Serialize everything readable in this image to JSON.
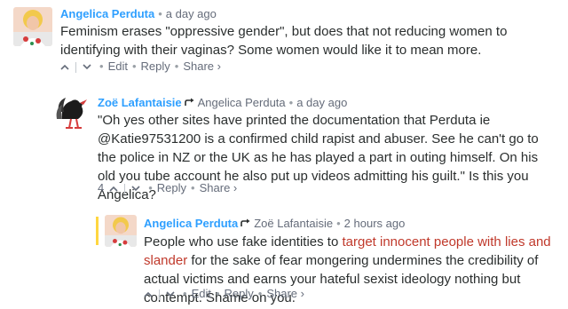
{
  "comments": [
    {
      "author": "Angelica Perduta",
      "parent": "",
      "time": "a day ago",
      "body_parts": [
        "Feminism erases \"oppressive gender\", but does that not reducing women to identifying with their vaginas? Some women would like it to mean more."
      ],
      "count": "",
      "actions": [
        "Edit",
        "Reply",
        "Share ›"
      ]
    },
    {
      "author": "Zoë Lafantaisie",
      "parent": "Angelica Perduta",
      "time": "a day ago",
      "body_parts": [
        "\"Oh yes other sites have printed the documentation that Perduta ie @Katie97531200 is a confirmed child rapist and abuser. See he can't go to the police in NZ or the UK as he has played a part in outing himself. On his old you tube account he also put up videos admitting his guilt.\" Is this you Angelica?"
      ],
      "count": "4",
      "actions": [
        "Reply",
        "Share ›"
      ]
    },
    {
      "author": "Angelica Perduta",
      "parent": "Zoë Lafantaisie",
      "time": "2 hours ago",
      "body_parts": [
        "People who use fake identities to ",
        "target innocent people with lies and slander",
        " for the sake of fear mongering undermines the credibility of actual victims and earns your hateful sexist ideology nothing but contempt. Shame on you."
      ],
      "count": "",
      "actions": [
        "Edit",
        "Reply",
        "Share ›"
      ]
    }
  ],
  "colors": {
    "author": "#2e9fff",
    "highlight": "#c0392b",
    "thread_line": "#ffd640",
    "text": "#2a2e2e",
    "meta": "#656c7a"
  },
  "icons": {
    "upvote": "chevron-up-icon",
    "downvote": "chevron-down-icon",
    "reply_to": "reply-arrow-icon"
  }
}
